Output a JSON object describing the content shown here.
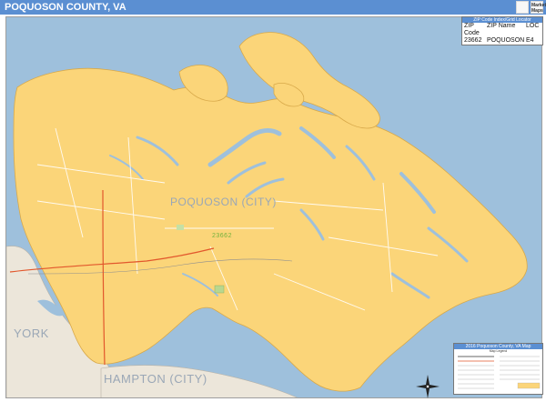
{
  "header": {
    "title": "POQUOSON COUNTY, VA",
    "logo_text": [
      "Market",
      "Maps"
    ]
  },
  "zip_table": {
    "heading": "ZIP Code Index/Grid Locator",
    "columns": [
      "ZIP Code",
      "ZIP Name",
      "LOC"
    ],
    "rows": [
      [
        "23662",
        "POQUOSON",
        "E4"
      ]
    ]
  },
  "map": {
    "labels": {
      "city": "POQUOSON (CITY)",
      "zip": "23662",
      "york": "YORK",
      "hampton": "HAMPTON (CITY)"
    },
    "colors": {
      "water": "#9ec0dc",
      "land": "#fbd579",
      "neighbor_land": "#ece6da",
      "roads": "#ffffff",
      "highway": "#e2572c"
    }
  },
  "legend": {
    "title": "2016 Poquoson County, VA Map",
    "subtitle": "Map Legend"
  },
  "compass": {
    "north_label": "N"
  }
}
